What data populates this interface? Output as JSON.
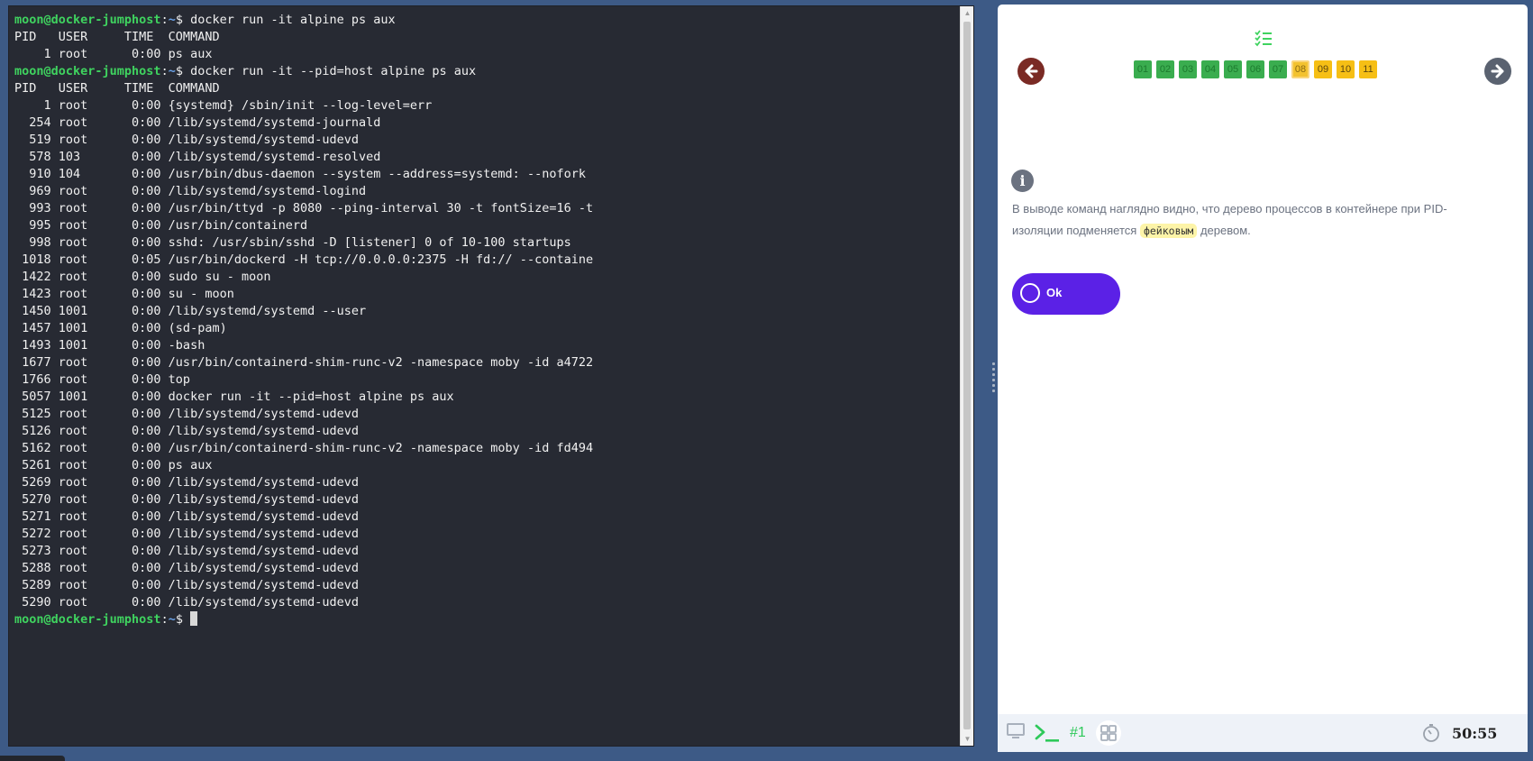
{
  "terminal": {
    "lines": [
      {
        "user": "moon@docker-jumphost",
        "path": "~",
        "cmd": "docker run -it alpine ps aux"
      },
      {
        "text": "PID   USER     TIME  COMMAND"
      },
      {
        "text": "    1 root      0:00 ps aux"
      },
      {
        "user": "moon@docker-jumphost",
        "path": "~",
        "cmd": "docker run -it --pid=host alpine ps aux"
      },
      {
        "text": "PID   USER     TIME  COMMAND"
      },
      {
        "text": "    1 root      0:00 {systemd} /sbin/init --log-level=err"
      },
      {
        "text": "  254 root      0:00 /lib/systemd/systemd-journald"
      },
      {
        "text": "  519 root      0:00 /lib/systemd/systemd-udevd"
      },
      {
        "text": "  578 103       0:00 /lib/systemd/systemd-resolved"
      },
      {
        "text": "  910 104       0:00 /usr/bin/dbus-daemon --system --address=systemd: --nofork"
      },
      {
        "text": "  969 root      0:00 /lib/systemd/systemd-logind"
      },
      {
        "text": "  993 root      0:00 /usr/bin/ttyd -p 8080 --ping-interval 30 -t fontSize=16 -t"
      },
      {
        "text": "  995 root      0:00 /usr/bin/containerd"
      },
      {
        "text": "  998 root      0:00 sshd: /usr/sbin/sshd -D [listener] 0 of 10-100 startups"
      },
      {
        "text": " 1018 root      0:05 /usr/bin/dockerd -H tcp://0.0.0.0:2375 -H fd:// --containe"
      },
      {
        "text": " 1422 root      0:00 sudo su - moon"
      },
      {
        "text": " 1423 root      0:00 su - moon"
      },
      {
        "text": " 1450 1001      0:00 /lib/systemd/systemd --user"
      },
      {
        "text": " 1457 1001      0:00 (sd-pam)"
      },
      {
        "text": " 1493 1001      0:00 -bash"
      },
      {
        "text": " 1677 root      0:00 /usr/bin/containerd-shim-runc-v2 -namespace moby -id a4722"
      },
      {
        "text": " 1766 root      0:00 top"
      },
      {
        "text": " 5057 1001      0:00 docker run -it --pid=host alpine ps aux"
      },
      {
        "text": " 5125 root      0:00 /lib/systemd/systemd-udevd"
      },
      {
        "text": " 5126 root      0:00 /lib/systemd/systemd-udevd"
      },
      {
        "text": " 5162 root      0:00 /usr/bin/containerd-shim-runc-v2 -namespace moby -id fd494"
      },
      {
        "text": " 5261 root      0:00 ps aux"
      },
      {
        "text": " 5269 root      0:00 /lib/systemd/systemd-udevd"
      },
      {
        "text": " 5270 root      0:00 /lib/systemd/systemd-udevd"
      },
      {
        "text": " 5271 root      0:00 /lib/systemd/systemd-udevd"
      },
      {
        "text": " 5272 root      0:00 /lib/systemd/systemd-udevd"
      },
      {
        "text": " 5273 root      0:00 /lib/systemd/systemd-udevd"
      },
      {
        "text": " 5288 root      0:00 /lib/systemd/systemd-udevd"
      },
      {
        "text": " 5289 root      0:00 /lib/systemd/systemd-udevd"
      },
      {
        "text": " 5290 root      0:00 /lib/systemd/systemd-udevd"
      },
      {
        "user": "moon@docker-jumphost",
        "path": "~",
        "cmd": "",
        "cursor": true
      }
    ]
  },
  "lesson": {
    "tasks_icon": "tasks-list-icon",
    "prev_icon": "arrow-left-icon",
    "next_icon": "arrow-right-icon",
    "steps": [
      {
        "label": "01",
        "state": "done"
      },
      {
        "label": "02",
        "state": "done"
      },
      {
        "label": "03",
        "state": "done"
      },
      {
        "label": "04",
        "state": "done"
      },
      {
        "label": "05",
        "state": "done"
      },
      {
        "label": "06",
        "state": "done"
      },
      {
        "label": "07",
        "state": "done"
      },
      {
        "label": "08",
        "state": "current"
      },
      {
        "label": "09",
        "state": "todo"
      },
      {
        "label": "10",
        "state": "todo"
      },
      {
        "label": "11",
        "state": "todo"
      }
    ],
    "info_icon": "i",
    "info_text_before": "В выводе команд наглядно видно, что дерево процессов в контейнере при PID-изоляции подменяется ",
    "info_highlight": "фейковым",
    "info_text_after": " деревом.",
    "ok_label": "Ok"
  },
  "bottom_bar": {
    "tab_number": "#1",
    "timer": "50:55"
  },
  "colors": {
    "prompt_user": "#3fd35f",
    "prompt_path": "#6aa2e8",
    "ok_button": "#5b21e6",
    "step_done": "#3aad4f",
    "step_todo": "#f6bf15"
  }
}
